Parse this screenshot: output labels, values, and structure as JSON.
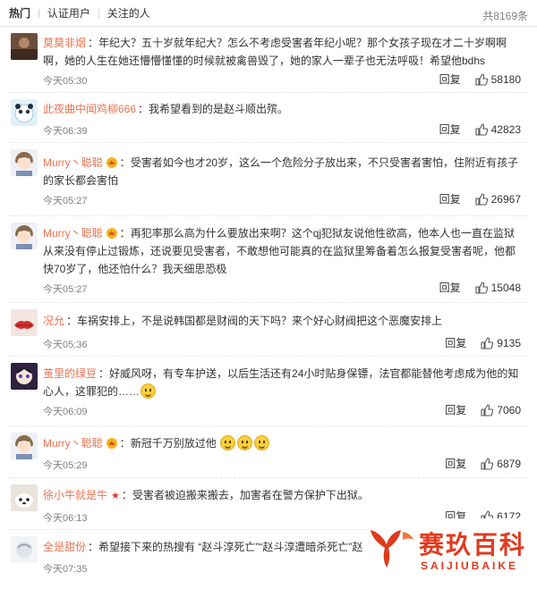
{
  "tabs": [
    {
      "label": "热门"
    },
    {
      "label": "认证用户"
    },
    {
      "label": "关注的人"
    }
  ],
  "total_count": "共8169条",
  "reply_label": "回复",
  "comments": [
    {
      "user": "莫莫非烟",
      "sep": "：",
      "text": "年纪大？五十岁就年纪大？怎么不考虑受害者年纪小呢？那个女孩子现在才二十岁啊啊啊，她的人生在她还懵懵懂懂的时候就被禽兽毁了，她的家人一辈子也无法呼吸！希望他bdhs",
      "time": "今天05:30",
      "likes": "58180"
    },
    {
      "user": "此夜曲中闻鸡柳666",
      "sep": "：",
      "text": "我希望看到的是赵斗顺出殡。",
      "time": "今天06:39",
      "likes": "42823"
    },
    {
      "user": "Murry丶聪聪",
      "sep": "：",
      "text": "受害者如今也才20岁，这么一个危险分子放出来，不只受害者害怕，住附近有孩子的家长都会害怕",
      "time": "今天05:27",
      "likes": "26967"
    },
    {
      "user": "Murry丶聪聪",
      "sep": "：",
      "text": "再犯率那么高为什么要放出来啊？这个qj犯狱友说他性欲高，他本人也一直在监狱从来没有停止过锻炼，还说要见受害者，不敢想他可能真的在监狱里筹备着怎么报复受害者呢，他都快70岁了，他还怕什么？我天细思恐极",
      "time": "今天05:27",
      "likes": "15048"
    },
    {
      "user": "况允",
      "sep": "：",
      "text": "车祸安排上，不是说韩国都是财阀的天下吗？来个好心财阀把这个恶魔安排上",
      "time": "今天05:36",
      "likes": "9135"
    },
    {
      "user": "茧里的绿豆",
      "sep": "：",
      "text": "好威风呀，有专车护送，以后生活还有24小时贴身保镖，法官都能替他考虑成为他的知心人，这罪犯的……",
      "time": "今天06:09",
      "likes": "7060"
    },
    {
      "user": "Murry丶聪聪",
      "sep": "：",
      "text": "新冠千万别放过他",
      "time": "今天05:29",
      "likes": "6879"
    },
    {
      "user": "徐小牛就是牛",
      "sep": "：",
      "text": "受害者被迫搬来搬去，加害者在警方保护下出狱。",
      "time": "今天06:13",
      "likes": "6172"
    },
    {
      "user": "全是甜份",
      "sep": "：",
      "text": "希望接下来的热搜有 “赵斗淳死亡”“赵斗淳遭暗杀死亡”赵",
      "time": "今天07:35",
      "likes": ""
    }
  ],
  "watermark": {
    "title": "赛玖百科",
    "subtitle": "SAIJIUBAIKE"
  },
  "colors": {
    "username": "#eb7350",
    "watermark": "#e03a1e",
    "meta": "#808080"
  }
}
